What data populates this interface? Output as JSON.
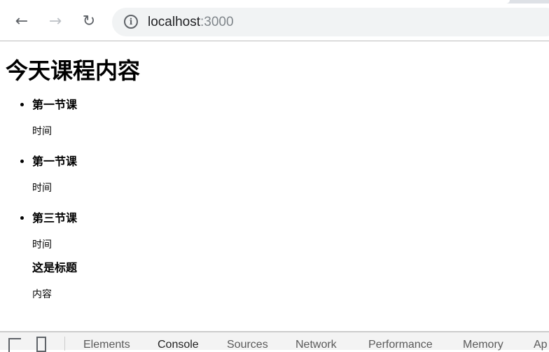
{
  "browser": {
    "url_host": "localhost",
    "url_port": ":3000",
    "icons": {
      "back": "arrow-left-icon",
      "forward": "arrow-right-icon",
      "reload": "reload-icon",
      "info": "info-icon"
    }
  },
  "page": {
    "title": "今天课程内容",
    "list": [
      {
        "heading": "第一节课",
        "text": "时间"
      },
      {
        "heading": "第一节课",
        "text": "时间"
      },
      {
        "heading": "第三节课",
        "text": "时间"
      }
    ],
    "extra": {
      "heading": "这是标题",
      "text": "内容"
    }
  },
  "devtools": {
    "tabs": [
      "Elements",
      "Console",
      "Sources",
      "Network",
      "Performance",
      "Memory",
      "Ap"
    ],
    "active": "Console"
  }
}
